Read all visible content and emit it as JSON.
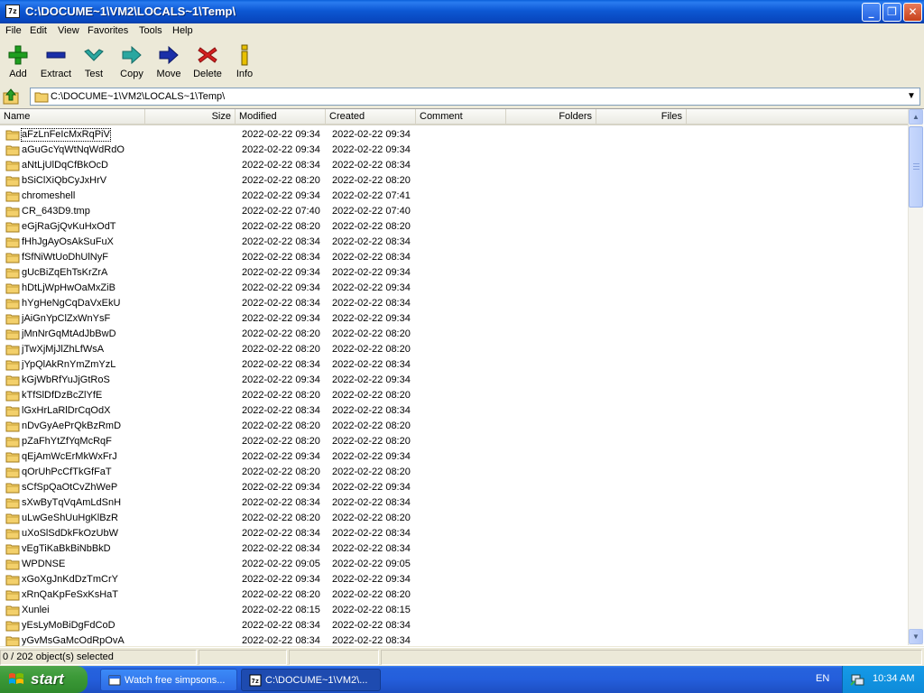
{
  "window": {
    "title": "C:\\DOCUME~1\\VM2\\LOCALS~1\\Temp\\",
    "icon_text": "7z",
    "buttons": [
      "minimize-icon",
      "restore-icon",
      "close-icon"
    ]
  },
  "menu": [
    "File",
    "Edit",
    "View",
    "Favorites",
    "Tools",
    "Help"
  ],
  "toolbar": [
    {
      "label": "Add",
      "icon": "plus-icon",
      "color": "#1f9e1f"
    },
    {
      "label": "Extract",
      "icon": "minus-icon",
      "color": "#1a2fa8"
    },
    {
      "label": "Test",
      "icon": "check-icon",
      "color": "#2aa7a0"
    },
    {
      "label": "Copy",
      "icon": "copy-arrow-icon",
      "color": "#2aa7a0"
    },
    {
      "label": "Move",
      "icon": "move-arrow-icon",
      "color": "#1a2fa8"
    },
    {
      "label": "Delete",
      "icon": "delete-x-icon",
      "color": "#d42020"
    },
    {
      "label": "Info",
      "icon": "info-icon",
      "color": "#c8a800"
    }
  ],
  "address": {
    "path": "C:\\DOCUME~1\\VM2\\LOCALS~1\\Temp\\"
  },
  "columns": [
    "Name",
    "Size",
    "Modified",
    "Created",
    "Comment",
    "Folders",
    "Files"
  ],
  "files": [
    {
      "name": "aFzLnFeIcMxRqPiV",
      "modified": "2022-02-22 09:34",
      "created": "2022-02-22 09:34"
    },
    {
      "name": "aGuGcYqWtNqWdRdO",
      "modified": "2022-02-22 09:34",
      "created": "2022-02-22 09:34"
    },
    {
      "name": "aNtLjUlDqCfBkOcD",
      "modified": "2022-02-22 08:34",
      "created": "2022-02-22 08:34"
    },
    {
      "name": "bSiClXiQbCyJxHrV",
      "modified": "2022-02-22 08:20",
      "created": "2022-02-22 08:20"
    },
    {
      "name": "chromeshell",
      "modified": "2022-02-22 09:34",
      "created": "2022-02-22 07:41"
    },
    {
      "name": "CR_643D9.tmp",
      "modified": "2022-02-22 07:40",
      "created": "2022-02-22 07:40"
    },
    {
      "name": "eGjRaGjQvKuHxOdT",
      "modified": "2022-02-22 08:20",
      "created": "2022-02-22 08:20"
    },
    {
      "name": "fHhJgAyOsAkSuFuX",
      "modified": "2022-02-22 08:34",
      "created": "2022-02-22 08:34"
    },
    {
      "name": "fSfNiWtUoDhUlNyF",
      "modified": "2022-02-22 08:34",
      "created": "2022-02-22 08:34"
    },
    {
      "name": "gUcBiZqEhTsKrZrA",
      "modified": "2022-02-22 09:34",
      "created": "2022-02-22 09:34"
    },
    {
      "name": "hDtLjWpHwOaMxZiB",
      "modified": "2022-02-22 09:34",
      "created": "2022-02-22 09:34"
    },
    {
      "name": "hYgHeNgCqDaVxEkU",
      "modified": "2022-02-22 08:34",
      "created": "2022-02-22 08:34"
    },
    {
      "name": "jAiGnYpClZxWnYsF",
      "modified": "2022-02-22 09:34",
      "created": "2022-02-22 09:34"
    },
    {
      "name": "jMnNrGqMtAdJbBwD",
      "modified": "2022-02-22 08:20",
      "created": "2022-02-22 08:20"
    },
    {
      "name": "jTwXjMjJlZhLfWsA",
      "modified": "2022-02-22 08:20",
      "created": "2022-02-22 08:20"
    },
    {
      "name": "jYpQlAkRnYmZmYzL",
      "modified": "2022-02-22 08:34",
      "created": "2022-02-22 08:34"
    },
    {
      "name": "kGjWbRfYuJjGtRoS",
      "modified": "2022-02-22 09:34",
      "created": "2022-02-22 09:34"
    },
    {
      "name": "kTfSlDfDzBcZlYfE",
      "modified": "2022-02-22 08:20",
      "created": "2022-02-22 08:20"
    },
    {
      "name": "lGxHrLaRlDrCqOdX",
      "modified": "2022-02-22 08:34",
      "created": "2022-02-22 08:34"
    },
    {
      "name": "nDvGyAePrQkBzRmD",
      "modified": "2022-02-22 08:20",
      "created": "2022-02-22 08:20"
    },
    {
      "name": "pZaFhYtZfYqMcRqF",
      "modified": "2022-02-22 08:20",
      "created": "2022-02-22 08:20"
    },
    {
      "name": "qEjAmWcErMkWxFrJ",
      "modified": "2022-02-22 09:34",
      "created": "2022-02-22 09:34"
    },
    {
      "name": "qOrUhPcCfTkGfFaT",
      "modified": "2022-02-22 08:20",
      "created": "2022-02-22 08:20"
    },
    {
      "name": "sCfSpQaOtCvZhWeP",
      "modified": "2022-02-22 09:34",
      "created": "2022-02-22 09:34"
    },
    {
      "name": "sXwByTqVqAmLdSnH",
      "modified": "2022-02-22 08:34",
      "created": "2022-02-22 08:34"
    },
    {
      "name": "uLwGeShUuHgKlBzR",
      "modified": "2022-02-22 08:20",
      "created": "2022-02-22 08:20"
    },
    {
      "name": "uXoSlSdDkFkOzUbW",
      "modified": "2022-02-22 08:34",
      "created": "2022-02-22 08:34"
    },
    {
      "name": "vEgTiKaBkBiNbBkD",
      "modified": "2022-02-22 08:34",
      "created": "2022-02-22 08:34"
    },
    {
      "name": "WPDNSE",
      "modified": "2022-02-22 09:05",
      "created": "2022-02-22 09:05"
    },
    {
      "name": "xGoXgJnKdDzTmCrY",
      "modified": "2022-02-22 09:34",
      "created": "2022-02-22 09:34"
    },
    {
      "name": "xRnQaKpFeSxKsHaT",
      "modified": "2022-02-22 08:20",
      "created": "2022-02-22 08:20"
    },
    {
      "name": "Xunlei",
      "modified": "2022-02-22 08:15",
      "created": "2022-02-22 08:15"
    },
    {
      "name": "yEsLyMoBiDgFdCoD",
      "modified": "2022-02-22 08:34",
      "created": "2022-02-22 08:34"
    },
    {
      "name": "yGvMsGaMcOdRpOvA",
      "modified": "2022-02-22 08:34",
      "created": "2022-02-22 08:34"
    }
  ],
  "status": {
    "selection": "0 / 202 object(s) selected"
  },
  "taskbar": {
    "start_label": "start",
    "tasks": [
      {
        "label": "Watch free simpsons...",
        "icon": "window-icon",
        "active": false
      },
      {
        "label": "C:\\DOCUME~1\\VM2\\...",
        "icon": "7zip-icon",
        "active": true
      }
    ],
    "language": "EN",
    "clock": "10:34 AM"
  },
  "colors": {
    "titlebar": "#0d58d4",
    "folder": "#f3d06b",
    "taskbar": "#245edb",
    "start": "#3c9a38"
  }
}
